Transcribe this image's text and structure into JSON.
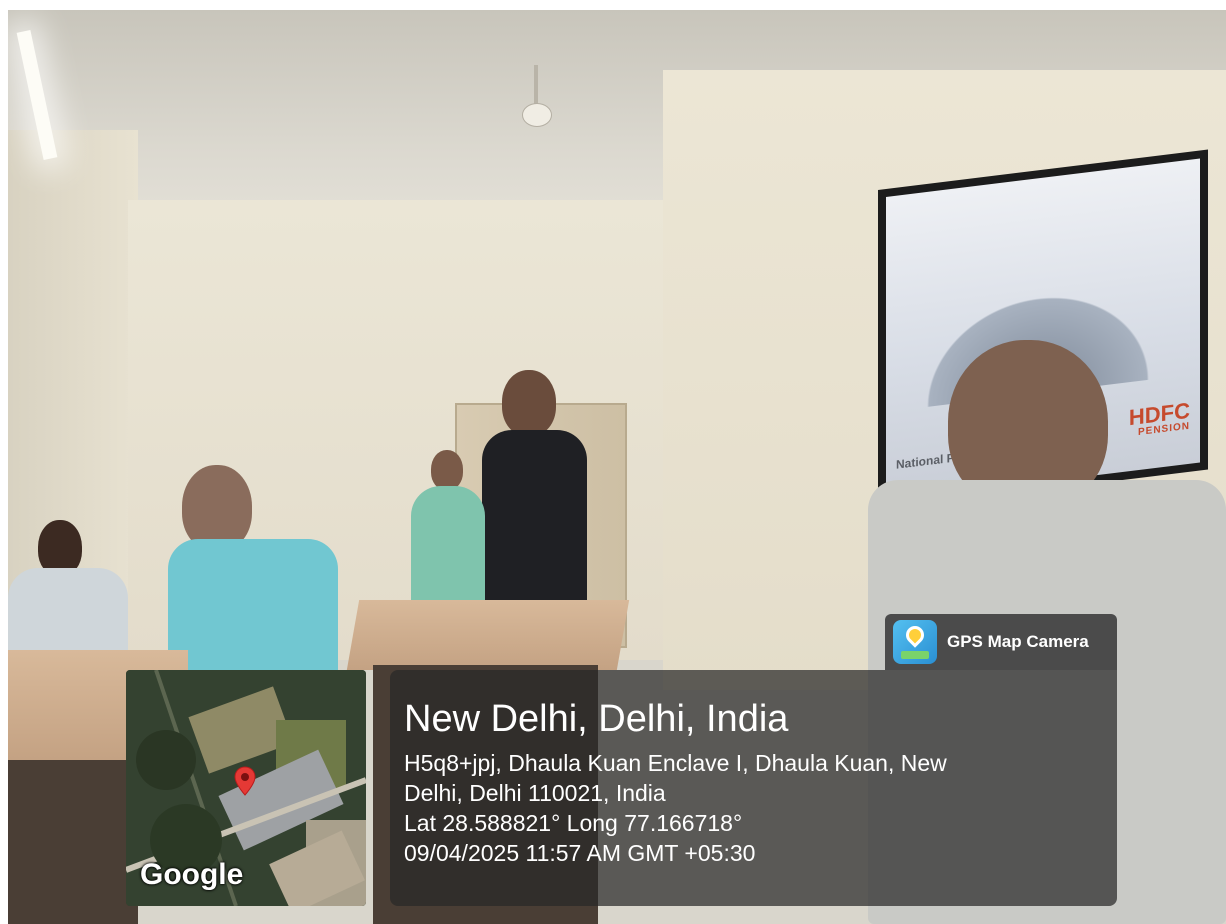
{
  "photo": {
    "projector_screen": {
      "caption_partial": "National P",
      "brand": "HDFC",
      "brand_sub": "PENSION"
    }
  },
  "gps_overlay": {
    "app_name": "GPS Map Camera",
    "app_icon": "map-pin-icon",
    "location_title": "New Delhi, Delhi, India",
    "address_line1": "H5q8+jpj, Dhaula Kuan Enclave I, Dhaula Kuan, New",
    "address_line2": "Delhi, Delhi 110021, India",
    "coordinates": "Lat 28.588821° Long 77.166718°",
    "timestamp": "09/04/2025 11:57 AM GMT +05:30",
    "map_provider": "Google",
    "marker_color": "#e53935"
  }
}
